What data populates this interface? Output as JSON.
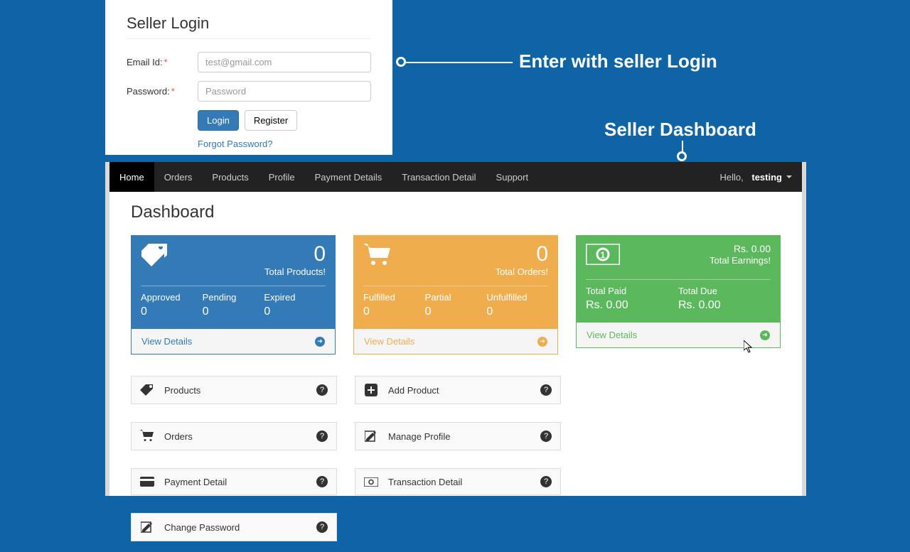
{
  "login": {
    "title": "Seller Login",
    "emailLabel": "Email Id:",
    "emailPlaceholder": "test@gmail.com",
    "passwordLabel": "Password:",
    "passwordPlaceholder": "Password",
    "loginBtn": "Login",
    "registerBtn": "Register",
    "forgot": "Forgot Password?"
  },
  "annotations": {
    "a1": "Enter with seller Login",
    "a2": "Seller Dashboard"
  },
  "nav": {
    "items": [
      "Home",
      "Orders",
      "Products",
      "Profile",
      "Payment Details",
      "Transaction Detail",
      "Support"
    ],
    "activeIndex": 0,
    "hello": "Hello,",
    "user": "testing"
  },
  "dashboard": {
    "title": "Dashboard",
    "cards": {
      "products": {
        "value": "0",
        "label": "Total Products!",
        "sub": [
          {
            "label": "Approved",
            "val": "0"
          },
          {
            "label": "Pending",
            "val": "0"
          },
          {
            "label": "Expired",
            "val": "0"
          }
        ],
        "footer": "View Details"
      },
      "orders": {
        "value": "0",
        "label": "Total Orders!",
        "sub": [
          {
            "label": "Fulfilled",
            "val": "0"
          },
          {
            "label": "Partial",
            "val": "0"
          },
          {
            "label": "Unfulfilled",
            "val": "0"
          }
        ],
        "footer": "View Details"
      },
      "earnings": {
        "value": "Rs. 0.00",
        "label": "Total Earnings!",
        "sub": [
          {
            "label": "Total Paid",
            "val": "Rs. 0.00"
          },
          {
            "label": "Total Due",
            "val": "Rs. 0.00"
          }
        ],
        "footer": "View Details"
      }
    },
    "links": [
      "Products",
      "Add Product",
      "Orders",
      "Manage Profile",
      "Payment Detail",
      "Transaction Detail",
      "Change Password"
    ]
  }
}
